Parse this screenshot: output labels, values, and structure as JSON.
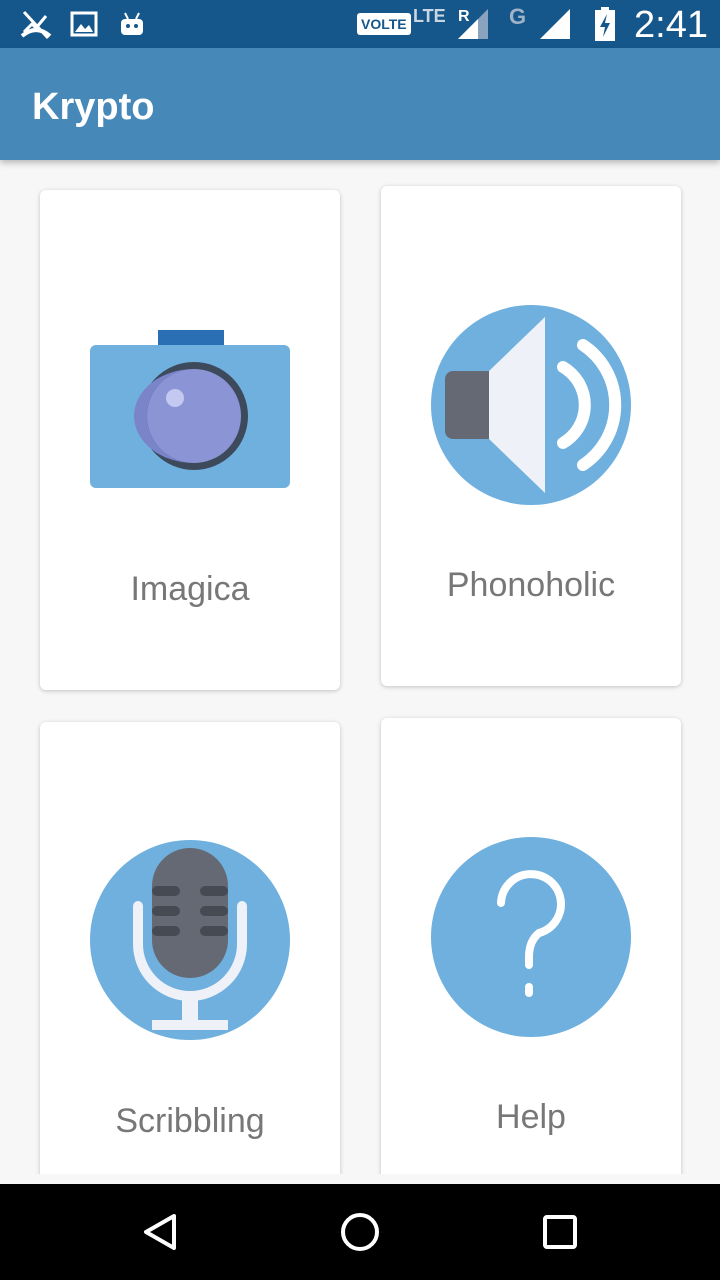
{
  "statusbar": {
    "volte": "VOLTE",
    "lte": "LTE",
    "roaming": "R",
    "network_type": "G",
    "time": "2:41"
  },
  "appbar": {
    "title": "Krypto"
  },
  "cards": [
    {
      "label": "Imagica",
      "icon": "camera-icon"
    },
    {
      "label": "Phonoholic",
      "icon": "speaker-icon"
    },
    {
      "label": "Scribbling",
      "icon": "microphone-icon"
    },
    {
      "label": "Help",
      "icon": "question-icon"
    }
  ],
  "colors": {
    "statusbar": "#15578a",
    "appbar": "#4688b7",
    "icon_blue": "#6fb0de",
    "icon_dark": "#656973"
  }
}
